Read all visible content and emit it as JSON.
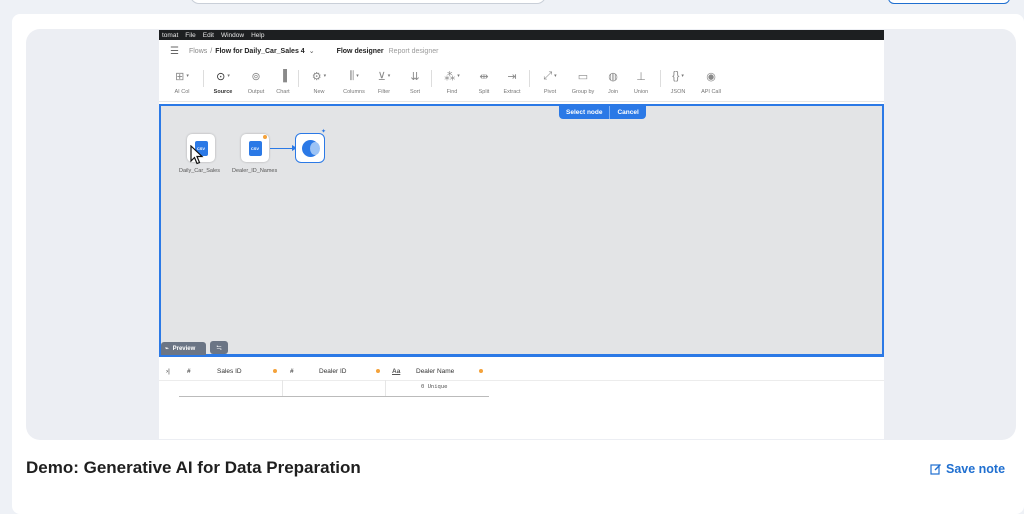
{
  "app_menu": [
    "tomat",
    "File",
    "Edit",
    "Window",
    "Help"
  ],
  "breadcrumb": {
    "root": "Flows",
    "separator": "/",
    "current": "Flow for Daily_Car_Sales 4"
  },
  "modes": {
    "active": "Flow designer",
    "inactive": "Report designer"
  },
  "toolbar": {
    "items": [
      {
        "label": "AI Col",
        "icon": "ai-column-icon"
      },
      {
        "label": "Source",
        "icon": "source-icon"
      },
      {
        "label": "Output",
        "icon": "output-icon"
      },
      {
        "label": "Chart",
        "icon": "chart-icon"
      },
      {
        "label": "New",
        "icon": "new-icon"
      },
      {
        "label": "Columns",
        "icon": "columns-icon"
      },
      {
        "label": "Filter",
        "icon": "filter-icon"
      },
      {
        "label": "Sort",
        "icon": "sort-icon"
      },
      {
        "label": "Find",
        "icon": "find-icon"
      },
      {
        "label": "Split",
        "icon": "split-icon"
      },
      {
        "label": "Extract",
        "icon": "extract-icon"
      },
      {
        "label": "Pivot",
        "icon": "pivot-icon"
      },
      {
        "label": "Group by",
        "icon": "group-by-icon"
      },
      {
        "label": "Join",
        "icon": "join-icon"
      },
      {
        "label": "Union",
        "icon": "union-icon"
      },
      {
        "label": "JSON",
        "icon": "json-icon"
      },
      {
        "label": "API Call",
        "icon": "api-call-icon"
      }
    ]
  },
  "select_bar": {
    "select": "Select node",
    "cancel": "Cancel"
  },
  "nodes": [
    {
      "label": "Daily_Car_Sales",
      "badge": "CSV"
    },
    {
      "label": "Dealer_ID_Names",
      "badge": "CSV"
    }
  ],
  "preview": {
    "tab": "Preview"
  },
  "grid": {
    "columns": [
      {
        "type": "#",
        "name": "Sales ID"
      },
      {
        "type": "#",
        "name": "Dealer ID"
      },
      {
        "type": "Aa",
        "name": "Dealer Name"
      }
    ],
    "summary": "0 Unique"
  },
  "caption": "Demo: Generative AI for Data Preparation",
  "save_note": "Save note",
  "colors": {
    "accent": "#2b79e6",
    "link": "#1f6fd0",
    "warn_dot": "#f4a23b"
  }
}
